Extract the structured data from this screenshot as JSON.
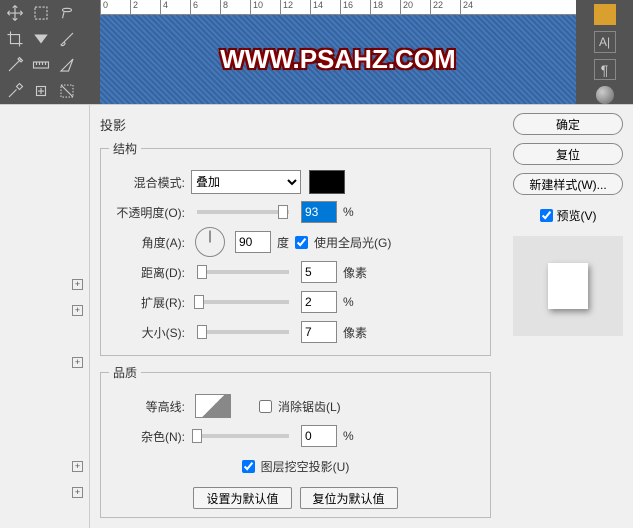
{
  "ruler": [
    "0",
    "2",
    "4",
    "6",
    "8",
    "10",
    "12",
    "14",
    "16",
    "18",
    "20",
    "22",
    "24"
  ],
  "canvas": {
    "watermark": "WWW.PSAHZ.COM"
  },
  "right_icons": {
    "a_label": "A|"
  },
  "dialog": {
    "title": "投影",
    "section_structure": "结构",
    "section_quality": "品质",
    "blend_mode": {
      "label": "混合模式:",
      "value": "叠加"
    },
    "opacity": {
      "label": "不透明度(O):",
      "value": "93",
      "unit": "%"
    },
    "angle": {
      "label": "角度(A):",
      "value": "90",
      "unit": "度",
      "global_light": "使用全局光(G)"
    },
    "distance": {
      "label": "距离(D):",
      "value": "5",
      "unit": "像素"
    },
    "spread": {
      "label": "扩展(R):",
      "value": "2",
      "unit": "%"
    },
    "size": {
      "label": "大小(S):",
      "value": "7",
      "unit": "像素"
    },
    "contour": {
      "label": "等高线:",
      "antialias": "消除锯齿(L)"
    },
    "noise": {
      "label": "杂色(N):",
      "value": "0",
      "unit": "%"
    },
    "knockout": "图层挖空投影(U)",
    "btn_default": "设置为默认值",
    "btn_reset_default": "复位为默认值"
  },
  "sidebar": {
    "ok": "确定",
    "cancel": "复位",
    "new_style": "新建样式(W)...",
    "preview": "预览(V)"
  }
}
